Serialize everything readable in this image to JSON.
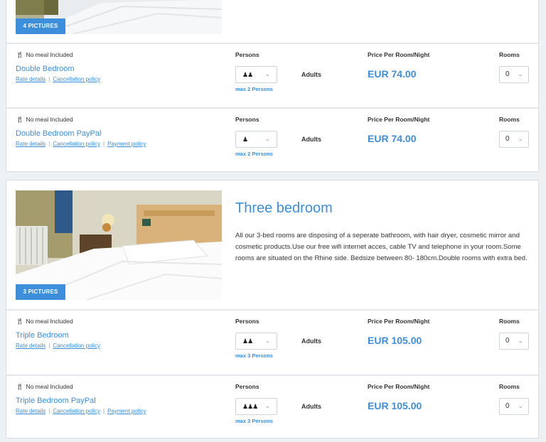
{
  "card1": {
    "pictures_label": "4 PICTURES",
    "rates": [
      {
        "meal": "No meal Included",
        "name": "Double Bedroom",
        "links": [
          "Rate details",
          "Cancellation policy"
        ],
        "persons_label": "Persons",
        "persons_icon": "♟♟",
        "max_persons": "max 2 Persons",
        "adults_label": "Adults",
        "price_label": "Price Per Room/Night",
        "price": "EUR 74.00",
        "rooms_label": "Rooms",
        "rooms_value": "0"
      },
      {
        "meal": "No meal Included",
        "name": "Double Bedroom PayPal",
        "links": [
          "Rate details",
          "Cancellation policy",
          "Payment policy"
        ],
        "persons_label": "Persons",
        "persons_icon": "♟",
        "max_persons": "max 2 Persons",
        "adults_label": "Adults",
        "price_label": "Price Per Room/Night",
        "price": "EUR 74.00",
        "rooms_label": "Rooms",
        "rooms_value": "0"
      }
    ]
  },
  "card2": {
    "pictures_label": "3 PICTURES",
    "title": "Three bedroom",
    "description": "All our 3-bed rooms are disposing of a seperate bathroom, with hair dryer, cosmetic mirror and cosmetic products.Use our free wifi internet acces, cable TV and telephone in your room.Some rooms are situated on the Rhine side. Bedsize between 80- 180cm.Double rooms with extra bed.",
    "rates": [
      {
        "meal": "No meal Included",
        "name": "Triple Bedroom",
        "links": [
          "Rate details",
          "Cancellation policy"
        ],
        "persons_label": "Persons",
        "persons_icon": "♟♟",
        "max_persons": "max 3 Persons",
        "adults_label": "Adults",
        "price_label": "Price Per Room/Night",
        "price": "EUR 105.00",
        "rooms_label": "Rooms",
        "rooms_value": "0"
      },
      {
        "meal": "No meal Included",
        "name": "Triple Bedroom PayPal",
        "links": [
          "Rate details",
          "Cancellation policy",
          "Payment policy"
        ],
        "persons_label": "Persons",
        "persons_icon": "♟♟♟",
        "max_persons": "max 3 Persons",
        "adults_label": "Adults",
        "price_label": "Price Per Room/Night",
        "price": "EUR 105.00",
        "rooms_label": "Rooms",
        "rooms_value": "0"
      }
    ]
  },
  "icons": {
    "meal": "fork-knife-icon",
    "persons": "person-icon",
    "dropdown": "chevron-down-icon"
  },
  "colors": {
    "accent": "#3d8fdb",
    "border": "#d6dde3",
    "background": "#eef1f4"
  }
}
